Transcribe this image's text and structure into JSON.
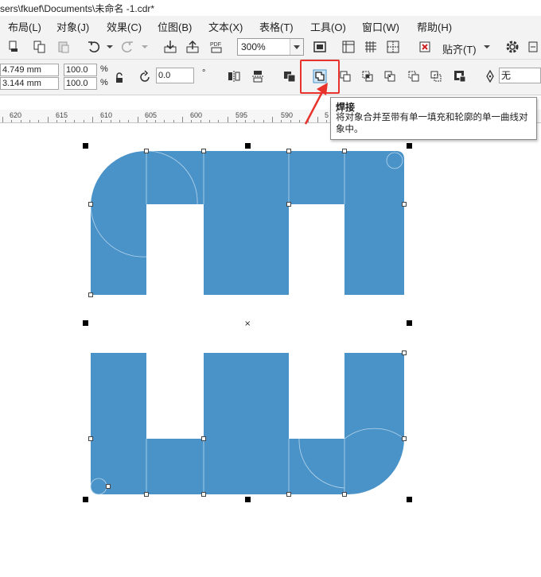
{
  "window": {
    "title": "sers\\fkuef\\Documents\\未命名 -1.cdr*"
  },
  "menu": {
    "items": [
      "布局(L)",
      "对象(J)",
      "效果(C)",
      "位图(B)",
      "文本(X)",
      "表格(T)",
      "工具(O)",
      "窗口(W)",
      "帮助(H)"
    ]
  },
  "toolbar": {
    "zoom_value": "300%",
    "snap_label": "贴齐(T)"
  },
  "property_bar": {
    "width_value": "4.749 mm",
    "height_value": "3.144 mm",
    "scale_x": "100.0",
    "scale_y": "100.0",
    "percent_unit": "%",
    "rotation_value": "0.0",
    "degree_unit": "°",
    "outline_value": "无"
  },
  "ruler": {
    "labels": [
      "620",
      "615",
      "610",
      "605",
      "600",
      "595",
      "590",
      "5"
    ]
  },
  "tooltip": {
    "title": "焊接",
    "description": "将对象合并至带有单一填充和轮廓的单一曲线对象中。"
  },
  "colors": {
    "shape_fill": "#4a93c8",
    "highlight": "#e8322c",
    "toolbar_bg": "#f3f3f3"
  }
}
